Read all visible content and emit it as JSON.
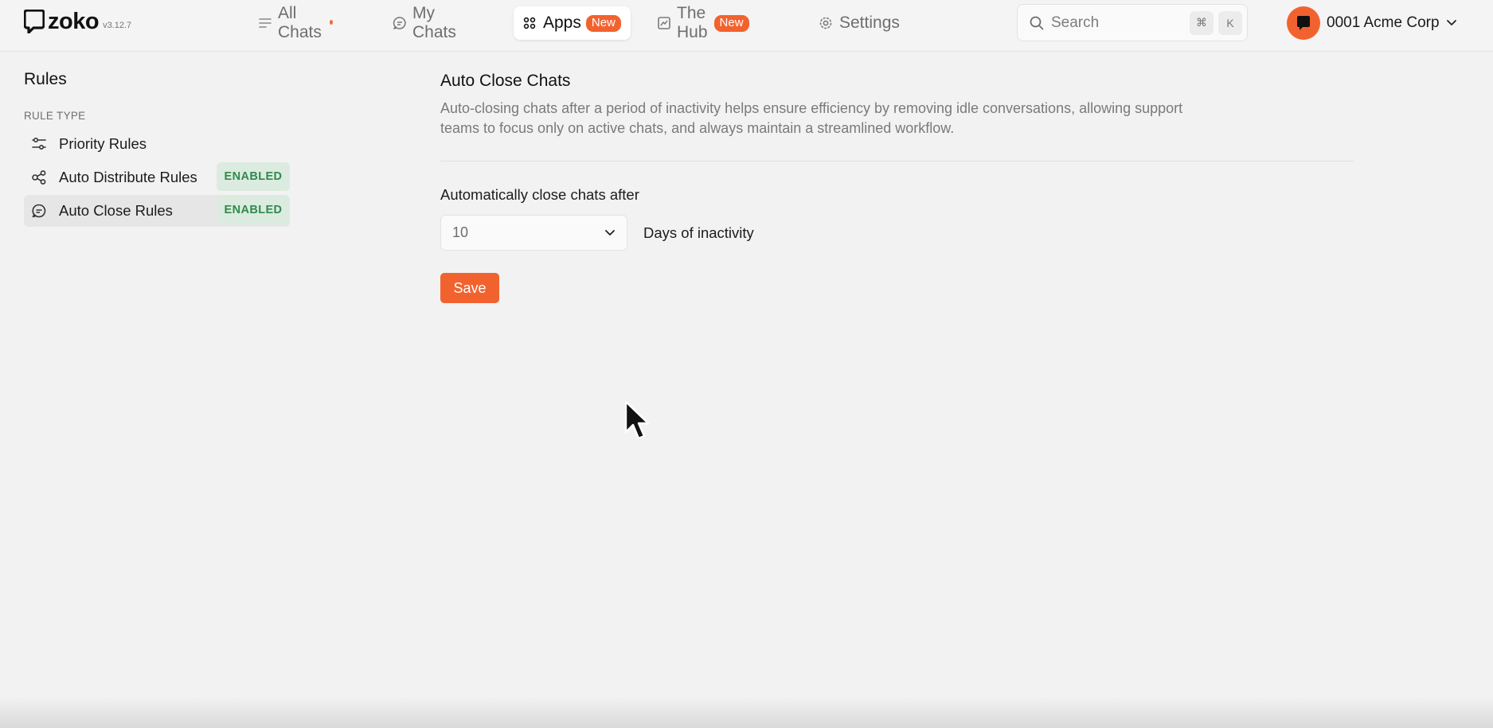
{
  "app": {
    "logo_text": "zoko",
    "version": "v3.12.7"
  },
  "nav": {
    "all_chats": "All Chats",
    "my_chats": "My Chats",
    "apps": "Apps",
    "apps_badge": "New",
    "the_hub": "The Hub",
    "the_hub_badge": "New",
    "settings": "Settings"
  },
  "search": {
    "placeholder": "Search",
    "shortcut_mod": "⌘",
    "shortcut_key": "K"
  },
  "account": {
    "name": "0001 Acme Corp"
  },
  "sidebar": {
    "title": "Rules",
    "section_label": "RULE TYPE",
    "items": [
      {
        "label": "Priority Rules",
        "icon": "sliders-icon",
        "status": ""
      },
      {
        "label": "Auto Distribute Rules",
        "icon": "share-nodes-icon",
        "status": "ENABLED"
      },
      {
        "label": "Auto Close Rules",
        "icon": "chat-close-icon",
        "status": "ENABLED"
      }
    ]
  },
  "main": {
    "title": "Auto Close Chats",
    "description": "Auto-closing chats after a period of inactivity helps ensure efficiency by removing idle conversations, allowing support teams to focus only on active chats, and always maintain a streamlined workflow.",
    "field_label": "Automatically close chats after",
    "days_value": "10",
    "days_suffix": "Days of inactivity",
    "save_label": "Save"
  },
  "colors": {
    "accent": "#f2622f",
    "enabled_bg": "#dcebdf",
    "enabled_text": "#2f8a4d"
  }
}
